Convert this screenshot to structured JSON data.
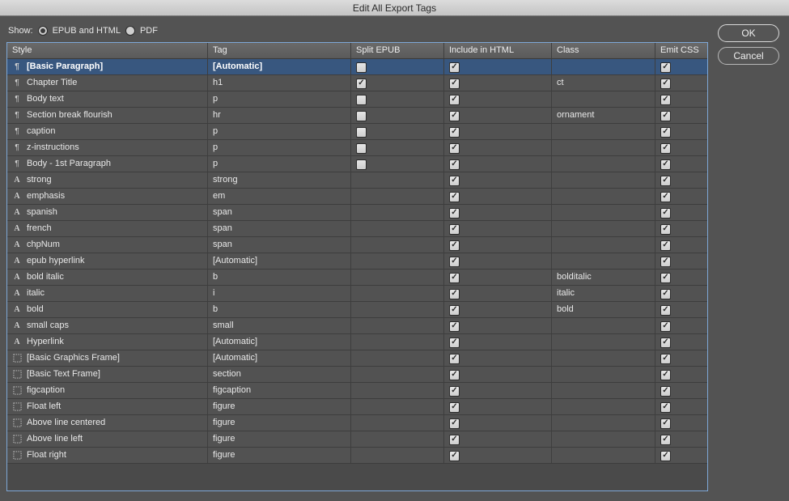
{
  "title": "Edit All Export Tags",
  "show": {
    "label": "Show:",
    "option_epub_html": "EPUB and HTML",
    "option_pdf": "PDF",
    "selected": "epub_html"
  },
  "buttons": {
    "ok": "OK",
    "cancel": "Cancel"
  },
  "columns": {
    "style": "Style",
    "tag": "Tag",
    "split": "Split EPUB",
    "include": "Include in HTML",
    "class": "Class",
    "emit": "Emit CSS"
  },
  "rows": [
    {
      "icon": "para",
      "style": "[Basic Paragraph]",
      "tag": "[Automatic]",
      "split": false,
      "include": true,
      "class": "",
      "emit": true,
      "selected": true
    },
    {
      "icon": "para",
      "style": "Chapter Title",
      "tag": "h1",
      "split": true,
      "include": true,
      "class": "ct",
      "emit": true
    },
    {
      "icon": "para",
      "style": "Body text",
      "tag": "p",
      "split": false,
      "include": true,
      "class": "",
      "emit": true
    },
    {
      "icon": "para",
      "style": "Section break flourish",
      "tag": "hr",
      "split": false,
      "include": true,
      "class": "ornament",
      "emit": true
    },
    {
      "icon": "para",
      "style": "caption",
      "tag": "p",
      "split": false,
      "include": true,
      "class": "",
      "emit": true
    },
    {
      "icon": "para",
      "style": "z-instructions",
      "tag": "p",
      "split": false,
      "include": true,
      "class": "",
      "emit": true
    },
    {
      "icon": "para",
      "style": "Body - 1st Paragraph",
      "tag": "p",
      "split": false,
      "include": true,
      "class": "",
      "emit": true
    },
    {
      "icon": "char",
      "style": "strong",
      "tag": "strong",
      "split": null,
      "include": true,
      "class": "",
      "emit": true
    },
    {
      "icon": "char",
      "style": "emphasis",
      "tag": "em",
      "split": null,
      "include": true,
      "class": "",
      "emit": true
    },
    {
      "icon": "char",
      "style": "spanish",
      "tag": "span",
      "split": null,
      "include": true,
      "class": "",
      "emit": true
    },
    {
      "icon": "char",
      "style": "french",
      "tag": "span",
      "split": null,
      "include": true,
      "class": "",
      "emit": true
    },
    {
      "icon": "char",
      "style": "chpNum",
      "tag": "span",
      "split": null,
      "include": true,
      "class": "",
      "emit": true
    },
    {
      "icon": "char",
      "style": "epub hyperlink",
      "tag": "[Automatic]",
      "split": null,
      "include": true,
      "class": "",
      "emit": true
    },
    {
      "icon": "char",
      "style": "bold italic",
      "tag": "b",
      "split": null,
      "include": true,
      "class": "bolditalic",
      "emit": true
    },
    {
      "icon": "char",
      "style": "italic",
      "tag": "i",
      "split": null,
      "include": true,
      "class": "italic",
      "emit": true
    },
    {
      "icon": "char",
      "style": "bold",
      "tag": "b",
      "split": null,
      "include": true,
      "class": "bold",
      "emit": true
    },
    {
      "icon": "char",
      "style": "small caps",
      "tag": "small",
      "split": null,
      "include": true,
      "class": "",
      "emit": true
    },
    {
      "icon": "char",
      "style": "Hyperlink",
      "tag": "[Automatic]",
      "split": null,
      "include": true,
      "class": "",
      "emit": true
    },
    {
      "icon": "obj",
      "style": "[Basic Graphics Frame]",
      "tag": "[Automatic]",
      "split": null,
      "include": true,
      "class": "",
      "emit": true
    },
    {
      "icon": "obj",
      "style": "[Basic Text Frame]",
      "tag": "section",
      "split": null,
      "include": true,
      "class": "",
      "emit": true
    },
    {
      "icon": "obj",
      "style": "figcaption",
      "tag": "figcaption",
      "split": null,
      "include": true,
      "class": "",
      "emit": true
    },
    {
      "icon": "obj",
      "style": "Float left",
      "tag": "figure",
      "split": null,
      "include": true,
      "class": "",
      "emit": true
    },
    {
      "icon": "obj",
      "style": "Above line centered",
      "tag": "figure",
      "split": null,
      "include": true,
      "class": "",
      "emit": true
    },
    {
      "icon": "obj",
      "style": "Above line left",
      "tag": "figure",
      "split": null,
      "include": true,
      "class": "",
      "emit": true
    },
    {
      "icon": "obj",
      "style": "Float right",
      "tag": "figure",
      "split": null,
      "include": true,
      "class": "",
      "emit": true
    }
  ]
}
